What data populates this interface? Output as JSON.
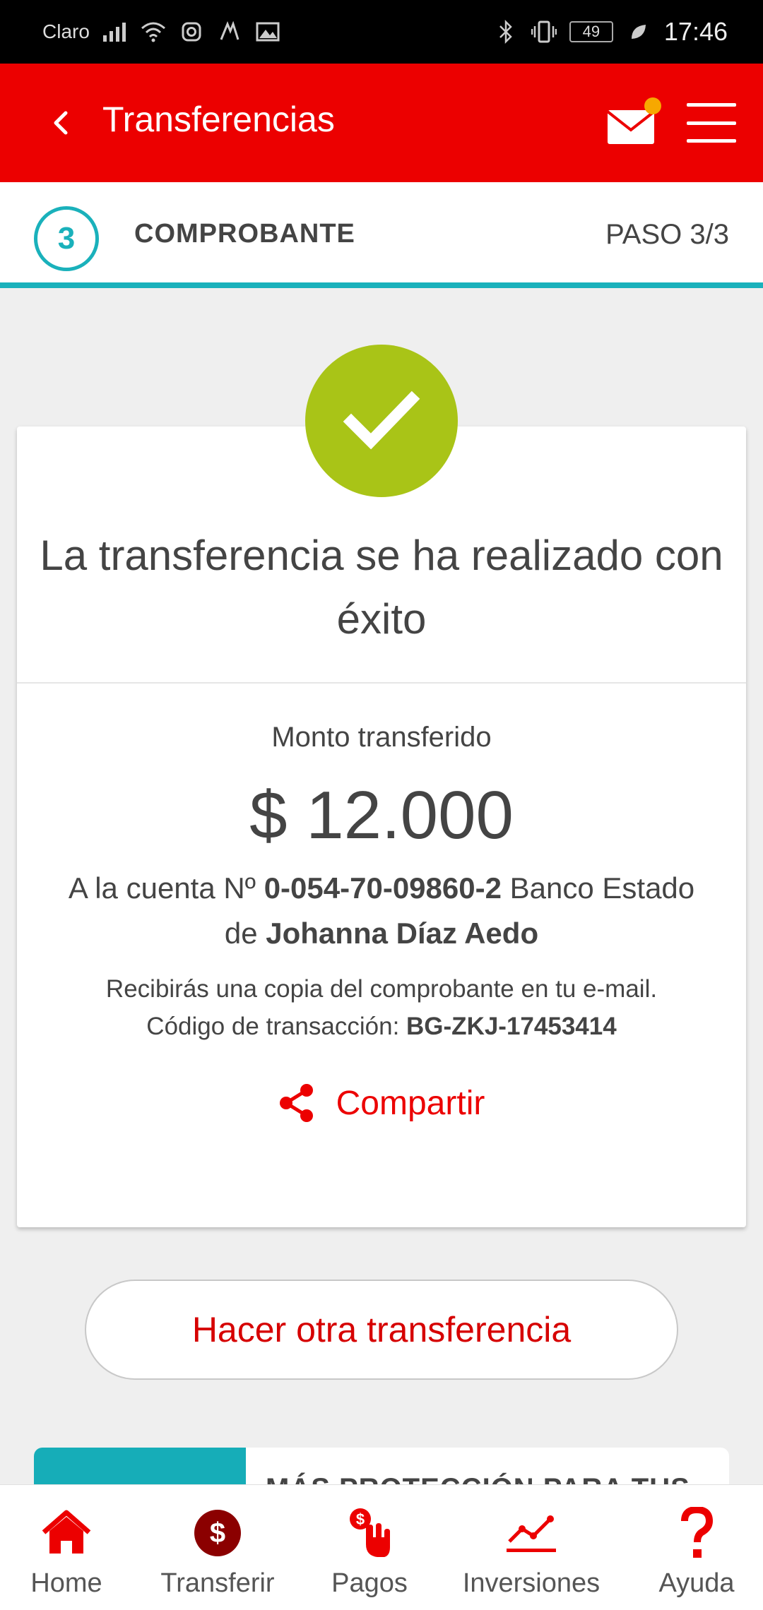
{
  "status_bar": {
    "carrier": "Claro",
    "battery": "49",
    "time": "17:46"
  },
  "app_bar": {
    "title": "Transferencias",
    "accent_color": "#ec0000",
    "notification_color": "#f7a800"
  },
  "stepper": {
    "number": "3",
    "label": "COMPROBANTE",
    "count": "PASO 3/3",
    "color": "#1ab1bb"
  },
  "receipt": {
    "success_message": "La transferencia se ha realizado con éxito",
    "amount_label": "Monto transferido",
    "amount": "$ 12.000",
    "account_prefix": "A la cuenta Nº",
    "account_number": "0-054-70-09860-2",
    "bank": "Banco Estado",
    "holder_prefix": "de",
    "holder_name": "Johanna Díaz Aedo",
    "email_note": "Recibirás una copia del comprobante en tu e-mail.",
    "transaction_label": "Código de transacción:",
    "transaction_code": "BG-ZKJ-17453414",
    "share_label": "Compartir",
    "success_color": "#a9c417"
  },
  "actions": {
    "again_label": "Hacer otra transferencia"
  },
  "promo": {
    "title": "MÁS PROTECCIÓN PARA TUS"
  },
  "bottom_nav": {
    "items": [
      {
        "label": "Home",
        "icon": "home-icon"
      },
      {
        "label": "Transferir",
        "icon": "dollar-icon"
      },
      {
        "label": "Pagos",
        "icon": "hand-payment-icon"
      },
      {
        "label": "Inversiones",
        "icon": "trend-chart-icon"
      },
      {
        "label": "Ayuda",
        "icon": "question-icon"
      }
    ]
  }
}
